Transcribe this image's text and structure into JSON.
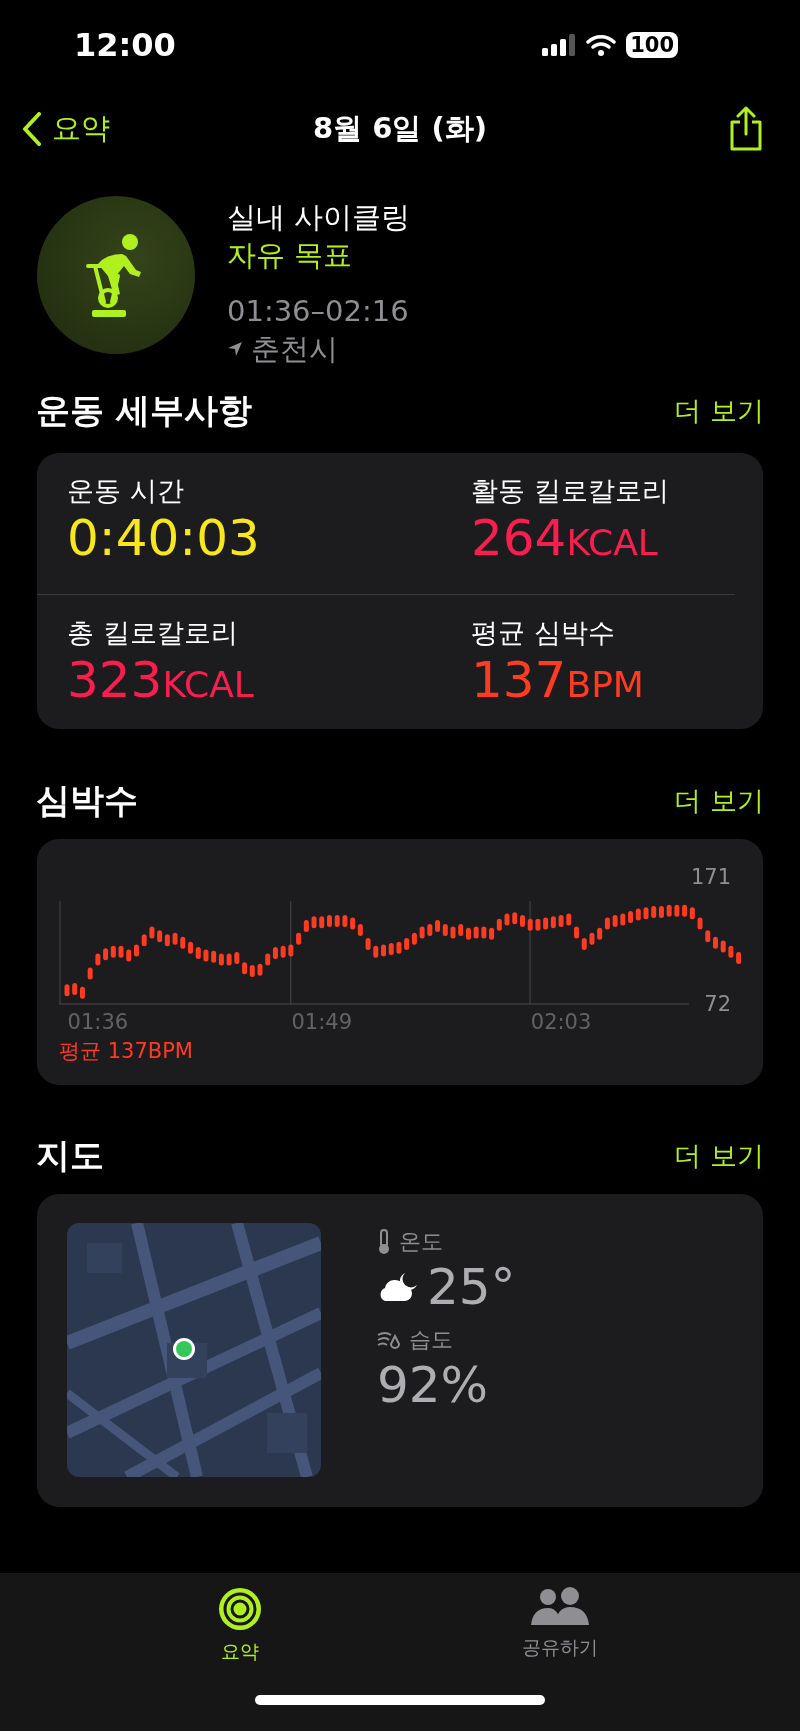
{
  "status_bar": {
    "time": "12:00",
    "battery": "100"
  },
  "nav": {
    "back": "요약",
    "title": "8월 6일 (화)"
  },
  "workout": {
    "name": "실내 사이클링",
    "goal": "자유 목표",
    "time_range": "01:36–02:16",
    "location": "춘천시"
  },
  "details": {
    "title": "운동 세부사항",
    "more": "더 보기",
    "metrics": [
      {
        "label": "운동 시간",
        "value": "0:40:03",
        "color": "#f8e71c"
      },
      {
        "label": "활동 킬로칼로리",
        "value": "264",
        "unit": "KCAL",
        "color": "#fa1e4e"
      },
      {
        "label": "총 킬로칼로리",
        "value": "323",
        "unit": "KCAL",
        "color": "#fa1e4e"
      },
      {
        "label": "평균 심박수",
        "value": "137",
        "unit": "BPM",
        "color": "#ff3b22"
      }
    ]
  },
  "heart_rate": {
    "title": "심박수",
    "more": "더 보기",
    "average": "평균 137BPM",
    "chart_data": {
      "type": "scatter",
      "ylim": [
        12,
        204
      ],
      "yticks": [
        72,
        171
      ],
      "categories": [
        null,
        null,
        null,
        null,
        "01:36",
        null,
        null,
        null,
        null,
        null,
        null,
        null,
        null,
        null,
        null,
        null,
        null,
        null,
        null,
        null,
        null,
        null,
        null,
        null,
        null,
        null,
        null,
        null,
        null,
        null,
        null,
        null,
        null,
        "01:49",
        null,
        null,
        null,
        null,
        null,
        null,
        null,
        null,
        null,
        null,
        null,
        null,
        null,
        null,
        null,
        null,
        null,
        null,
        null,
        null,
        null,
        null,
        null,
        null,
        null,
        null,
        null,
        null,
        null,
        null,
        "02:03",
        null,
        null,
        null,
        null,
        null,
        null,
        null,
        null,
        null,
        null,
        null,
        null,
        null,
        null,
        null,
        null,
        null,
        null,
        null,
        null,
        null,
        null,
        null
      ],
      "series": [
        {
          "color": "#ff3b22",
          "values": [
            86,
            87,
            84,
            99,
            110,
            114,
            116,
            116,
            113,
            117,
            125,
            131,
            128,
            125,
            126,
            123,
            119,
            115,
            113,
            112,
            110,
            110,
            111,
            103,
            101,
            102,
            110,
            115,
            116,
            117,
            126,
            136,
            139,
            139,
            140,
            140,
            140,
            138,
            133,
            122,
            116,
            117,
            118,
            119,
            122,
            126,
            131,
            133,
            136,
            133,
            131,
            133,
            130,
            131,
            131,
            130,
            137,
            141,
            142,
            140,
            137,
            137,
            138,
            139,
            140,
            141,
            131,
            122,
            126,
            130,
            138,
            140,
            141,
            143,
            145,
            146,
            147,
            147,
            148,
            148,
            148,
            146,
            138,
            128,
            123,
            120,
            116,
            111
          ]
        }
      ]
    }
  },
  "map": {
    "title": "지도",
    "more": "더 보기",
    "weather": {
      "temp_label": "온도",
      "temp": "25°",
      "humidity_label": "습도",
      "humidity": "92%"
    }
  },
  "tabs": [
    {
      "label": "요약",
      "selected": true
    },
    {
      "label": "공유하기",
      "selected": false
    }
  ]
}
